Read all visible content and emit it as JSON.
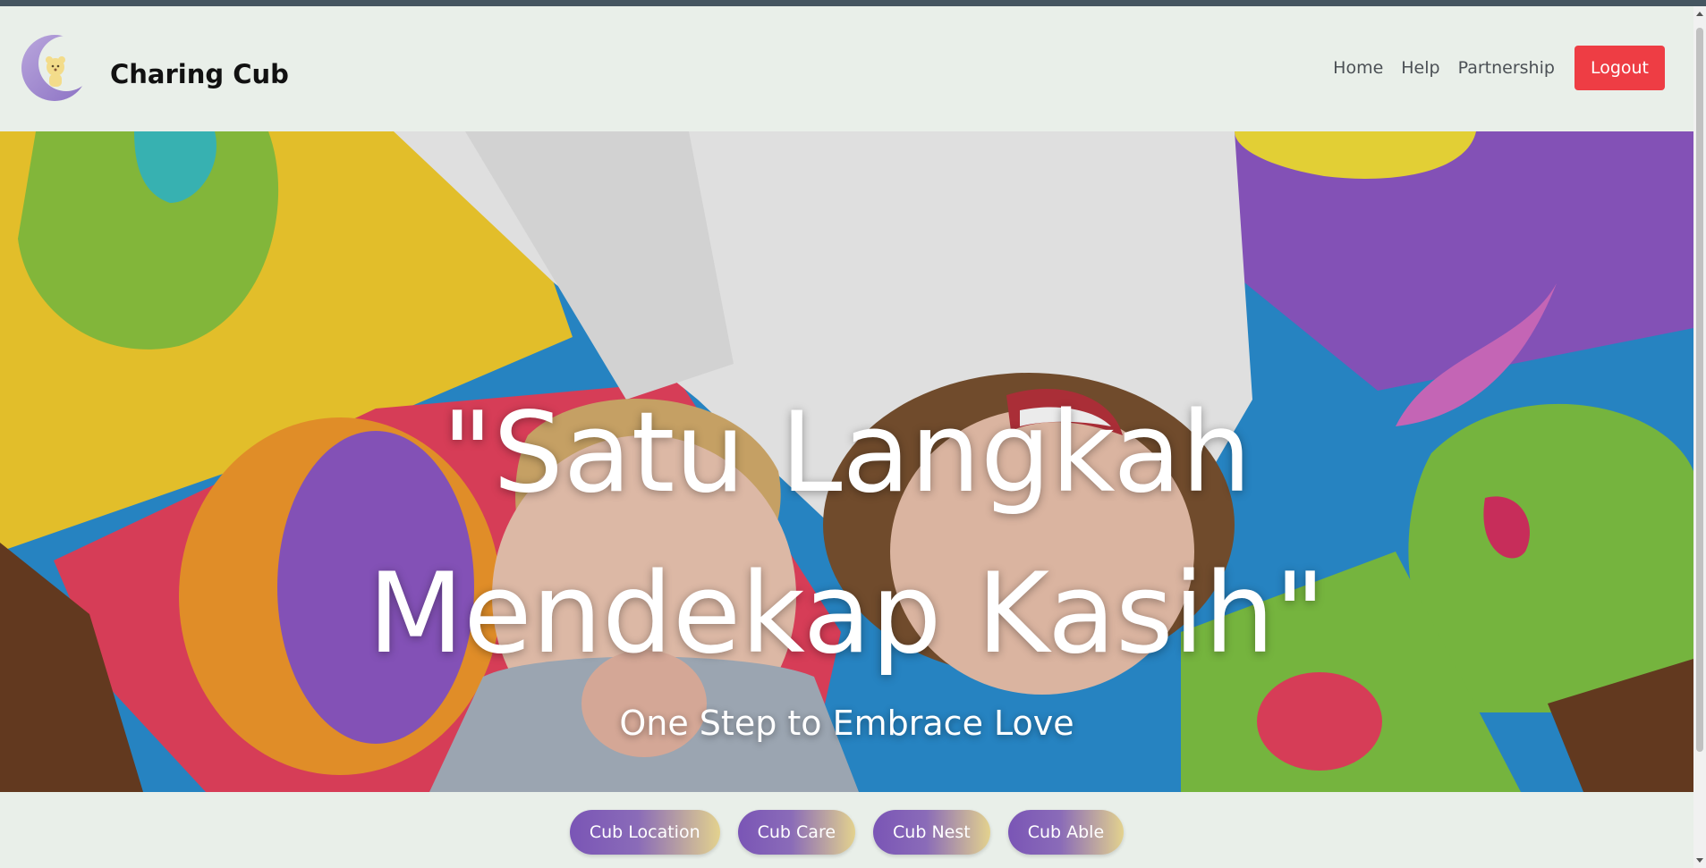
{
  "brand": {
    "name": "Charing Cub",
    "logo_icon": "moon-bear-logo-icon"
  },
  "nav": {
    "links": [
      {
        "label": "Home"
      },
      {
        "label": "Help"
      },
      {
        "label": "Partnership"
      }
    ],
    "logout_label": "Logout"
  },
  "hero": {
    "headline_line1": "\"Satu Langkah",
    "headline_line2": "Mendekap Kasih\"",
    "subtitle": "One Step to Embrace Love"
  },
  "categories": [
    {
      "label": "Cub Location"
    },
    {
      "label": "Cub Care"
    },
    {
      "label": "Cub Nest"
    },
    {
      "label": "Cub Able"
    }
  ],
  "colors": {
    "logout": "#ee3d44",
    "page_bg": "#e9efe9",
    "pill_gradient_start": "#7a55b6",
    "pill_gradient_end": "#e3d28e"
  }
}
